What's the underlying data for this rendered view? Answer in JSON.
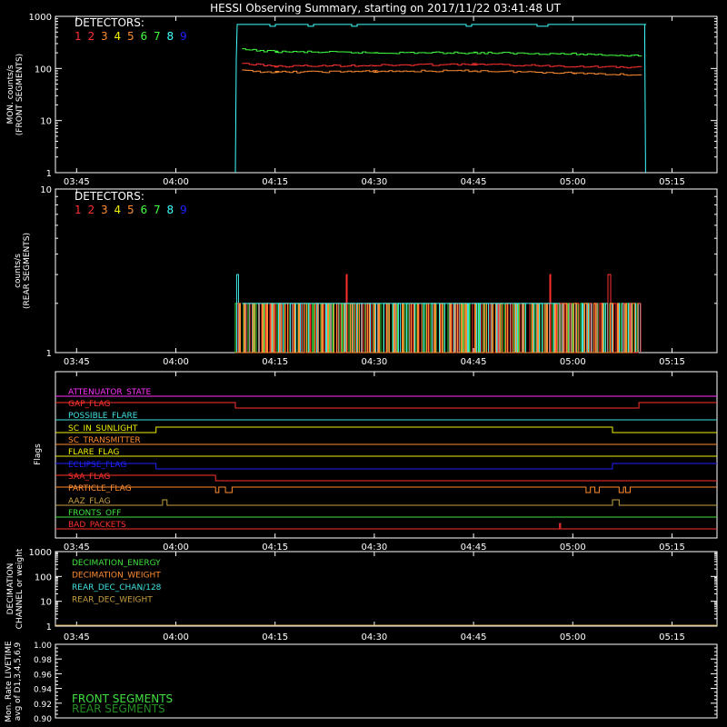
{
  "title": "HESSI Observing Summary, starting on 2017/11/22 03:41:48 UT",
  "time_ticks": [
    "03:45",
    "04:00",
    "04:15",
    "04:30",
    "04:45",
    "05:00",
    "05:15"
  ],
  "detector_colors": [
    "#ff3030",
    "#ff3030",
    "#ff8c30",
    "#f0f000",
    "#ff8c30",
    "#40ff40",
    "#40ff40",
    "#40ffff",
    "#2020ff"
  ],
  "colors": {
    "front": "#40e0e0",
    "green": "#40e040",
    "red": "#ff3030",
    "orange": "#ff8c30",
    "yellow": "#f0f000",
    "olive": "#c8a040",
    "magenta": "#ff30ff",
    "blue": "#2020ff",
    "white": "#ffffff"
  },
  "panels": {
    "front": {
      "ylabel": [
        "MON. counts/s",
        "(FRONT SEGMENTS)"
      ],
      "yticks": [
        "1",
        "10",
        "100",
        "1000"
      ],
      "legend_title": "DETECTORS:",
      "legend_numbers": [
        "1",
        "2",
        "3",
        "4",
        "5",
        "6",
        "7",
        "8",
        "9"
      ]
    },
    "rear": {
      "ylabel": [
        "counts/s",
        "(REAR SEGMENTS)"
      ],
      "yticks": [
        "1",
        "10"
      ],
      "legend_title": "DETECTORS:",
      "legend_numbers": [
        "1",
        "2",
        "3",
        "4",
        "5",
        "6",
        "7",
        "8",
        "9"
      ]
    },
    "flags": {
      "ylabel": "Flags",
      "rows": [
        {
          "label": "ATTENUATOR_STATE",
          "color": "#ff30ff"
        },
        {
          "label": "GAP_FLAG",
          "color": "#ff3030"
        },
        {
          "label": "POSSIBLE_FLARE",
          "color": "#40e0e0"
        },
        {
          "label": "SC_IN_SUNLIGHT",
          "color": "#f0f000"
        },
        {
          "label": "SC_TRANSMITTER",
          "color": "#ff8c30"
        },
        {
          "label": "FLARE_FLAG",
          "color": "#f0f000"
        },
        {
          "label": "ECLIPSE_FLAG",
          "color": "#2020ff"
        },
        {
          "label": "SAA_FLAG",
          "color": "#ff3030"
        },
        {
          "label": "PARTICLE_FLAG",
          "color": "#ff8c30"
        },
        {
          "label": "AAZ_FLAG",
          "color": "#c8a040"
        },
        {
          "label": "FRONTS_OFF",
          "color": "#40e040"
        },
        {
          "label": "BAD_PACKETS",
          "color": "#ff3030"
        }
      ]
    },
    "decimation": {
      "ylabel": [
        "DECIMATION",
        "CHANNEL or weight"
      ],
      "yticks": [
        "1",
        "10",
        "100",
        "1000"
      ],
      "legend": [
        {
          "label": "DECIMATION_ENERGY",
          "color": "#40e040"
        },
        {
          "label": "DECIMATION_WEIGHT",
          "color": "#ff8c30"
        },
        {
          "label": "REAR_DEC_CHAN/128",
          "color": "#40e0e0"
        },
        {
          "label": "REAR_DEC_WEIGHT",
          "color": "#c8a040"
        }
      ]
    },
    "livetime": {
      "ylabel": [
        "Mon. Rate LIVETIME",
        "avg of D1,3,4,5,6,9"
      ],
      "yticks": [
        "0.90",
        "0.92",
        "0.94",
        "0.96",
        "0.98",
        "1.00"
      ],
      "legend": [
        {
          "label": "FRONT SEGMENTS",
          "color": "#40e040"
        },
        {
          "label": "REAR SEGMENTS",
          "color": "#228b22"
        }
      ]
    }
  },
  "chart_data": [
    {
      "type": "line",
      "title": "HESSI Observing Summary, starting on 2017/11/22 03:41:48 UT",
      "ylabel": "MON. counts/s (FRONT SEGMENTS)",
      "yscale": "log",
      "ylim": [
        1,
        1000
      ],
      "x_start": "03:41:48",
      "x_end": "05:21:48",
      "series": [
        {
          "name": "8",
          "color": "#40ffff",
          "x": [
            "04:09",
            "04:10",
            "04:30",
            "04:50",
            "05:10",
            "05:11"
          ],
          "values": [
            1,
            700,
            700,
            700,
            700,
            1
          ]
        },
        {
          "name": "6",
          "color": "#40ff40",
          "x": [
            "04:10",
            "04:15",
            "04:30",
            "04:45",
            "05:00",
            "05:10"
          ],
          "values": [
            230,
            210,
            200,
            200,
            190,
            175
          ]
        },
        {
          "name": "1",
          "color": "#ff3030",
          "x": [
            "04:10",
            "04:15",
            "04:30",
            "04:45",
            "05:00",
            "05:10"
          ],
          "values": [
            125,
            110,
            115,
            120,
            110,
            105
          ]
        },
        {
          "name": "3",
          "color": "#ff8c30",
          "x": [
            "04:10",
            "04:15",
            "04:30",
            "04:45",
            "05:00",
            "05:10"
          ],
          "values": [
            90,
            85,
            88,
            90,
            82,
            75
          ]
        }
      ]
    },
    {
      "type": "line",
      "ylabel": "counts/s (REAR SEGMENTS)",
      "yscale": "log",
      "ylim": [
        1,
        10
      ],
      "note_values": "spiky counts between 1 and 3 from 04:09 to 05:10",
      "levels": [
        1,
        2,
        3
      ]
    },
    {
      "type": "line",
      "ylabel": "DECIMATION CHANNEL or weight",
      "yscale": "log",
      "ylim": [
        1,
        1000
      ],
      "series": [
        {
          "name": "REAR_DEC_WEIGHT",
          "color": "#c8a040",
          "values": [
            1,
            1
          ]
        }
      ]
    },
    {
      "type": "line",
      "ylabel": "Mon. Rate LIVETIME avg of D1,3,4,5,6,9",
      "ylim": [
        0.9,
        1.0
      ]
    }
  ]
}
